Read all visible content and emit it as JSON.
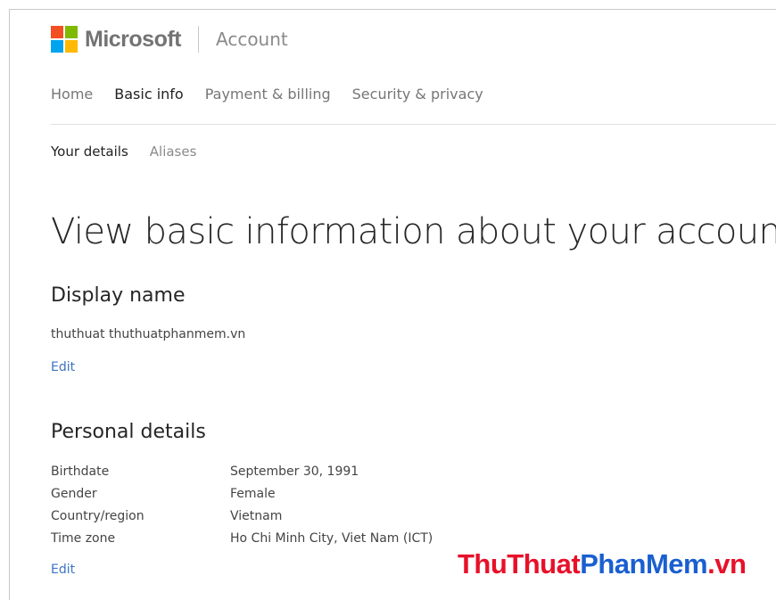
{
  "header": {
    "brand": "Microsoft",
    "product": "Account",
    "logo_colors": [
      "#f25022",
      "#7fba00",
      "#00a4ef",
      "#ffb900"
    ]
  },
  "primary_nav": {
    "items": [
      {
        "label": "Home",
        "active": false
      },
      {
        "label": "Basic info",
        "active": true
      },
      {
        "label": "Payment & billing",
        "active": false
      },
      {
        "label": "Security & privacy",
        "active": false
      }
    ]
  },
  "secondary_nav": {
    "items": [
      {
        "label": "Your details",
        "active": true
      },
      {
        "label": "Aliases",
        "active": false
      }
    ]
  },
  "main": {
    "title": "View basic information about your account",
    "display_name": {
      "heading": "Display name",
      "value": "thuthuat thuthuatphanmem.vn",
      "edit_label": "Edit"
    },
    "personal_details": {
      "heading": "Personal details",
      "rows": [
        {
          "label": "Birthdate",
          "value": "September 30, 1991"
        },
        {
          "label": "Gender",
          "value": "Female"
        },
        {
          "label": "Country/region",
          "value": "Vietnam"
        },
        {
          "label": "Time zone",
          "value": "Ho Chi Minh City, Viet Nam (ICT)"
        }
      ],
      "edit_label": "Edit"
    }
  },
  "watermark": {
    "part1": "ThuThuat",
    "part2": "PhanMem",
    "part3": ".vn",
    "colors": {
      "red": "#e8102a",
      "blue": "#1a5fd0"
    }
  },
  "colors": {
    "link": "#3c74c4",
    "active_text": "#222222",
    "muted_text": "#767676"
  }
}
